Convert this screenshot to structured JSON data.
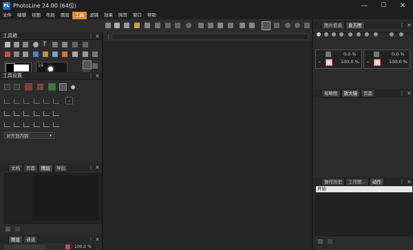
{
  "app": {
    "icon_label": "PL",
    "title": "PhotoLine 24.00 (64位)",
    "win_min": "—",
    "win_max": "☐",
    "win_close": "✕"
  },
  "menu": [
    {
      "label": "文件"
    },
    {
      "label": "编辑"
    },
    {
      "label": "视图"
    },
    {
      "label": "布局"
    },
    {
      "label": "图层"
    },
    {
      "label": "工具",
      "active": true
    },
    {
      "label": "滤镜"
    },
    {
      "label": "效果"
    },
    {
      "label": "网页"
    },
    {
      "label": "窗口"
    },
    {
      "label": "帮助"
    }
  ],
  "toolbox": {
    "title": "工具箱",
    "close": "×",
    "primary_color": "#000000",
    "secondary_color": "#ffffff",
    "brush_size": "19"
  },
  "tool_settings": {
    "title": "工具设置",
    "close": "×",
    "dropdown_value": "对齐到内容"
  },
  "doc_panel": {
    "tabs": [
      "文档",
      "页面",
      "图层",
      "导出"
    ],
    "active_tab": "图层",
    "close": "×"
  },
  "layers_panel": {
    "tabs": [
      "图层",
      "通道"
    ],
    "active_tab": "图层",
    "close": "×",
    "zoom_value": "100.0 %"
  },
  "info_panel": {
    "tabs": [
      "图片信息",
      "直方图"
    ],
    "active_tab": "直方图",
    "close": "×",
    "left": {
      "values": [
        "0.0 %",
        "100.0 %"
      ]
    },
    "right": {
      "values": [
        "0.0 %",
        "100.0 %"
      ]
    }
  },
  "nav_panel": {
    "tabs": [
      "缩略图",
      "放大镜",
      "页面"
    ],
    "active_tab": "放大镜",
    "close": "×"
  },
  "history_panel": {
    "tabs": [
      "操作历史",
      "工作图...",
      "动作"
    ],
    "active_tab": "动作",
    "close": "×",
    "items": [
      "开始"
    ]
  },
  "colors": {
    "accent": "#e08a2c",
    "titlebar": "#1e1e1e",
    "panel": "#2b2b2b"
  }
}
